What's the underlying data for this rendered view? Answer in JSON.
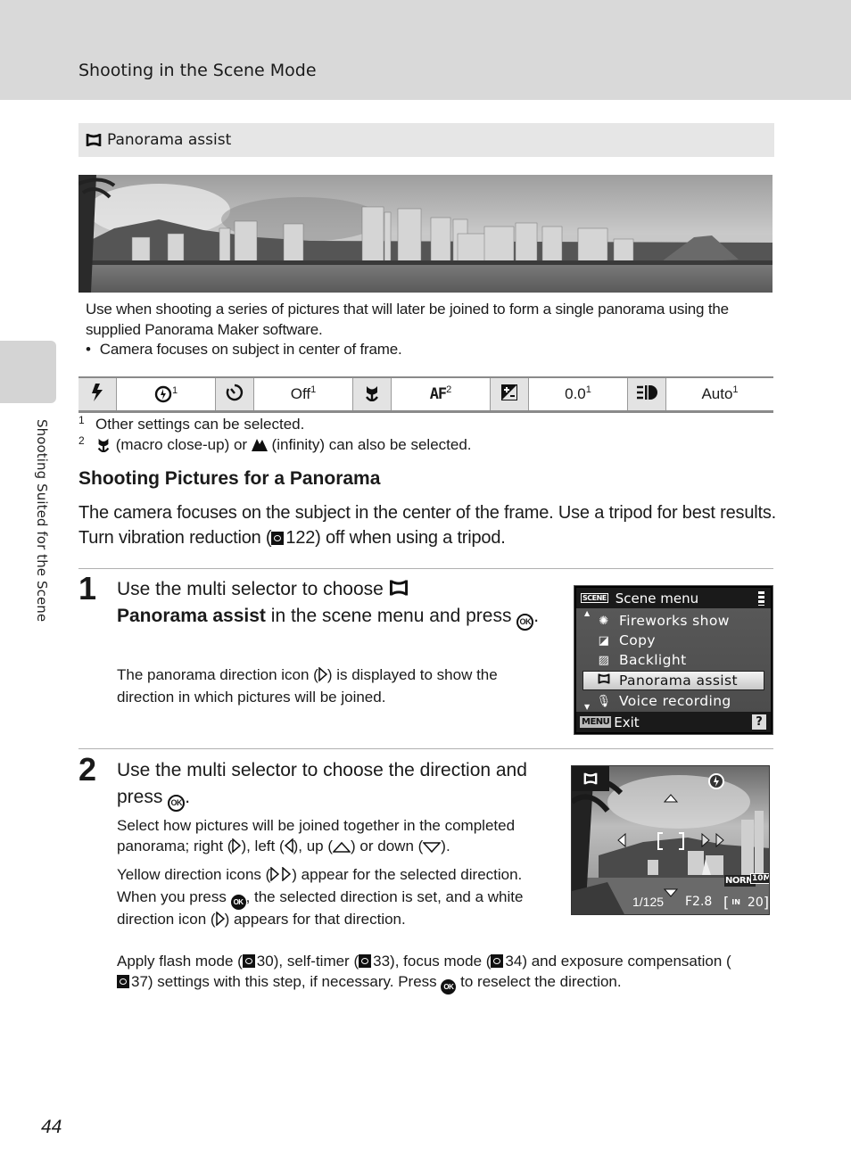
{
  "header": {
    "title": "Shooting in the Scene Mode"
  },
  "side_tab": {
    "label": "Shooting Suited for the Scene"
  },
  "section": {
    "icon": "panorama-assist-icon",
    "title": "Panorama assist"
  },
  "photo": {
    "description": "Panoramic photo of a city skyline with high-rise buildings, marina and mountains"
  },
  "description": {
    "paragraph": "Use when shooting a series of pictures that will later be joined to form a single panorama using the supplied Panorama Maker software.",
    "bullets": [
      "Camera focuses on subject in center of frame."
    ]
  },
  "settings_table": [
    {
      "icon": "flash-icon",
      "value": "",
      "value_icon": "flash-off-icon",
      "note": "1"
    },
    {
      "icon": "self-timer-icon",
      "value": "Off",
      "note": "1"
    },
    {
      "icon": "macro-icon",
      "value": "AF",
      "note": "2"
    },
    {
      "icon": "exposure-compensation-icon",
      "value": "0.0",
      "note": "1"
    },
    {
      "icon": "vibration-reduction-icon",
      "value": "Auto",
      "note": "1"
    }
  ],
  "footnotes": [
    {
      "num": "1",
      "text": "Other settings can be selected."
    },
    {
      "num": "2",
      "pre": "",
      "macro_text": " (macro close-up) or ",
      "infinity_text": " (infinity) can also be selected."
    }
  ],
  "subsection": {
    "title": "Shooting Pictures for a Panorama",
    "intro_1": "The camera focuses on the subject in the center of the frame. Use a tripod for best results. Turn vibration reduction (",
    "intro_ref": "122",
    "intro_2": ") off when using a tripod."
  },
  "steps": [
    {
      "number": "1",
      "head_1": "Use the multi selector to choose ",
      "head_bold": "Panorama assist",
      "head_2": " in the scene menu and press ",
      "head_3": ".",
      "body_1": "The panorama direction icon (",
      "body_2": ") is displayed to show the direction in which pictures will be joined."
    },
    {
      "number": "2",
      "head_1": "Use the multi selector to choose the direction and press ",
      "head_2": ".",
      "p1": {
        "a": "Select how pictures will be joined together in the completed panorama; right (",
        "b": "), left (",
        "c": "), up (",
        "d": ") or down (",
        "e": ")."
      },
      "p2": {
        "a": "Yellow direction icons (",
        "b": ") appear for the selected direction. When you press ",
        "c": ", the selected direction is set, and a white direction icon (",
        "d": ") appears for that direction."
      },
      "p3": {
        "a": "Apply flash mode (",
        "r1": "30",
        "b": "), self-timer (",
        "r2": "33",
        "c": "), focus mode (",
        "r3": "34",
        "d": ") and exposure compensation (",
        "r4": "37",
        "e": ") settings with this step, if necessary. Press ",
        "f": " to reselect the direction."
      }
    }
  ],
  "ok_button_label": "OK",
  "camera_menu": {
    "title": "Scene menu",
    "scene_badge": "SCENE",
    "items": [
      {
        "icon": "fireworks-icon",
        "label": "Fireworks show",
        "selected": false
      },
      {
        "icon": "copy-icon",
        "label": "Copy",
        "selected": false
      },
      {
        "icon": "backlight-icon",
        "label": "Backlight",
        "selected": false
      },
      {
        "icon": "panorama-assist-icon",
        "label": "Panorama assist",
        "selected": true
      },
      {
        "icon": "voice-recording-icon",
        "label": "Voice recording",
        "selected": false
      }
    ],
    "footer_key": "MENU",
    "footer_label": "Exit",
    "help": "?"
  },
  "camera_view": {
    "shutter": "1/125",
    "aperture": "F2.8",
    "image_mode": "NORM",
    "image_size": "10M",
    "memory": "IN",
    "remaining": "20"
  },
  "page_number": "44"
}
